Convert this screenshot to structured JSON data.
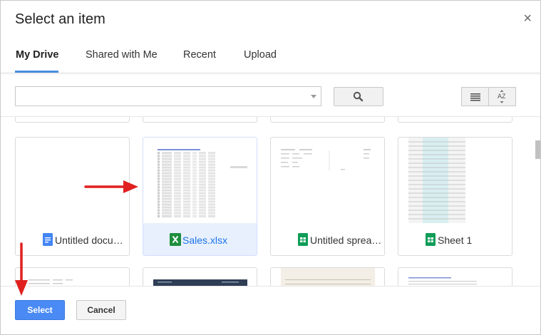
{
  "dialog": {
    "title": "Select an item",
    "close_glyph": "×"
  },
  "tabs": [
    {
      "label": "My Drive",
      "active": true
    },
    {
      "label": "Shared with Me",
      "active": false
    },
    {
      "label": "Recent",
      "active": false
    },
    {
      "label": "Upload",
      "active": false
    }
  ],
  "toolbar": {
    "search_value": "",
    "sort_glyph": "AZ"
  },
  "files": [
    {
      "name": "Untitled docu…",
      "type": "docs",
      "selected": false
    },
    {
      "name": "Sales.xlsx",
      "type": "excel",
      "selected": true
    },
    {
      "name": "Untitled sprea…",
      "type": "sheets",
      "selected": false
    },
    {
      "name": "Sheet 1",
      "type": "sheets",
      "selected": false
    }
  ],
  "footer": {
    "select_label": "Select",
    "cancel_label": "Cancel"
  },
  "colors": {
    "accent": "#4a8af4",
    "annotation_arrow": "#e02020",
    "docs": "#4285f4",
    "excel": "#1e8e3e",
    "sheets": "#0f9d58"
  }
}
